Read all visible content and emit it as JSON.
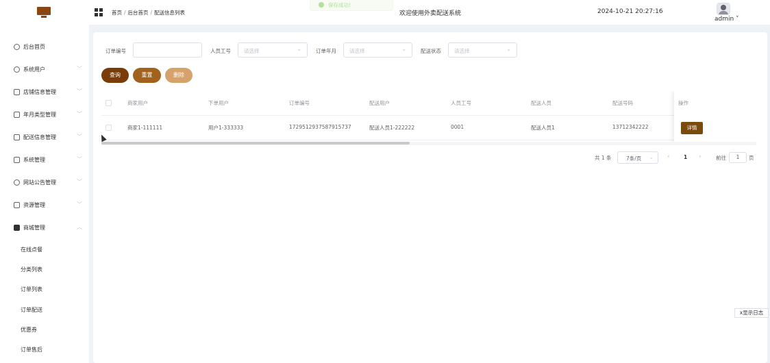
{
  "header": {
    "breadcrumb": [
      "首页",
      "后台首页",
      "配送信息列表"
    ],
    "breadcrumb_sep": "/",
    "toast": "保存成功!",
    "welcome": "欢迎使用外卖配送系统",
    "datetime": "2024-10-21 20:27:16",
    "username": "admin",
    "user_arrow": "˅"
  },
  "sidebar": {
    "items": [
      {
        "label": "后台首页",
        "icon": "clock-icon",
        "arrow": ""
      },
      {
        "label": "系统用户",
        "icon": "user-icon",
        "arrow": "﹀"
      },
      {
        "label": "店铺信息管理",
        "icon": "mail-icon",
        "arrow": "﹀"
      },
      {
        "label": "年月类型管理",
        "icon": "calendar-icon",
        "arrow": "﹀"
      },
      {
        "label": "配送信息管理",
        "icon": "check-box-icon",
        "arrow": "﹀"
      },
      {
        "label": "系统管理",
        "icon": "folder-icon",
        "arrow": "﹀"
      },
      {
        "label": "网站公告管理",
        "icon": "loading-icon",
        "arrow": "﹀"
      },
      {
        "label": "资源管理",
        "icon": "printer-icon",
        "arrow": "﹀"
      },
      {
        "label": "商城管理",
        "icon": "goods-icon",
        "arrow": "︿"
      }
    ],
    "subitems": [
      "在线点餐",
      "分类列表",
      "订单列表",
      "订单配送",
      "优惠券",
      "订单售后"
    ]
  },
  "filters": {
    "order_no_label": "订单编号",
    "order_no_value": "",
    "staff_no_label": "人员工号",
    "staff_no_placeholder": "请选择",
    "order_month_label": "订单年月",
    "order_month_placeholder": "请选择",
    "delivery_status_label": "配送状态",
    "delivery_status_placeholder": "请选择",
    "arrow": "⌄"
  },
  "actions": {
    "query": "查询",
    "reset": "重置",
    "delete": "删除"
  },
  "colors": {
    "query_btn": "#7a3d0a",
    "reset_btn": "#a0621c",
    "delete_btn": "#d4a26a"
  },
  "table": {
    "columns": [
      "商家用户",
      "下单用户",
      "订单编号",
      "配送用户",
      "人员工号",
      "配送人员",
      "配送号码",
      "操作"
    ],
    "rows": [
      {
        "merchant": "商家1-111111",
        "customer": "用户1-333333",
        "order_no": "1729512937587915737",
        "delivery_user": "配送人员1-222222",
        "staff_no": "0001",
        "delivery_person": "配送人员1",
        "phone": "13712342222",
        "action": "详情"
      }
    ]
  },
  "pagination": {
    "total": "共 1 条",
    "page_size": "7条/页",
    "size_arrow": "⌄",
    "prev": "‹",
    "next": "›",
    "current": "1",
    "goto_label": "前往",
    "goto_value": "1",
    "page_label": "页"
  },
  "log_button": "x显示日志"
}
